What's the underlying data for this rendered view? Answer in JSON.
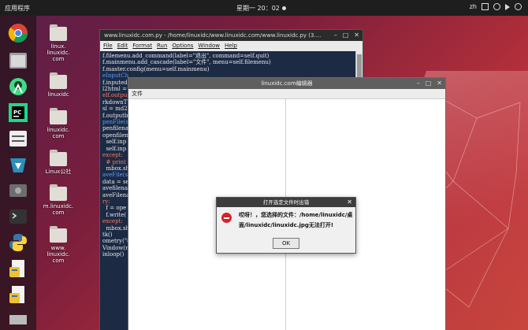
{
  "top_panel": {
    "activities": "应用程序",
    "clock": "星期一 20：02",
    "tray_lang": "zh"
  },
  "dock": {
    "items": [
      "chrome-icon",
      "files-icon",
      "android-studio-icon",
      "pycharm-icon",
      "settings-icon",
      "software-icon",
      "drive-icon",
      "terminal-icon",
      "python-icon",
      "python-doc-icon",
      "python-doc-icon-2",
      "show-apps-icon"
    ]
  },
  "desktop": {
    "icons": [
      "linux.\nlinuxidc.\ncom",
      "linuxidc",
      "linuxidc.\ncom",
      "Linux公社",
      "m.linuxidc.\ncom",
      "www.\nlinuxidc.\ncom"
    ]
  },
  "idle_window": {
    "title": "www.linuxidc.com.py - /home/linuxidc/www.linuxidc.com/www.linuxidc.py (3....",
    "menu": [
      "File",
      "Edit",
      "Format",
      "Run",
      "Options",
      "Window",
      "Help"
    ],
    "code": [
      "f.filemenu.add_command(label=\"退出\", command=self.quit)",
      "f.mainmenu.add_cascade(label=\"文件\", menu=self.filemenu)",
      "f.master.config(menu=self.mainmenu)",
      "",
      "eInputCh",
      "f.inputed",
      "l2html = ",
      "elf.outpu",
      "rkdownT",
      "sl = md2",
      "f.outputb",
      "",
      "penFile(se",
      "penfilenam",
      "",
      "openfilena",
      "",
      "  self.inp",
      "  self.inp",
      "except:",
      "  # print",
      "  mbox.sh",
      "",
      "aveFile(se",
      "data = se",
      "avefilenam",
      "",
      "aveFilenar",
      "ry:",
      "  f = ope",
      "  f.write(",
      "except:",
      "  mbox.sh",
      "",
      "tk()",
      "ometry(\"8",
      "Vindow(ro",
      "inloop()"
    ]
  },
  "editor_window": {
    "title": "linuxidc.com编辑器",
    "menu_file": "文件"
  },
  "dialog": {
    "title": "打开选定文件时出错",
    "message": "哎呀！，您选择的文件：/home/linuxidc/桌面/linuxidc/linuxidc.jpg无法打开!",
    "ok_label": "OK"
  }
}
